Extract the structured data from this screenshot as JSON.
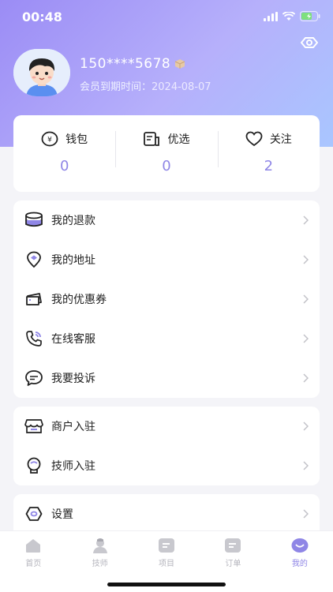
{
  "status": {
    "time": "00:48"
  },
  "profile": {
    "phone": "150****5678",
    "expire_label": "会员到期时间：",
    "expire_date": "2024-08-07"
  },
  "stats": [
    {
      "icon": "wallet-icon",
      "label": "钱包",
      "value": "0"
    },
    {
      "icon": "select-icon",
      "label": "优选",
      "value": "0"
    },
    {
      "icon": "heart-icon",
      "label": "关注",
      "value": "2"
    }
  ],
  "menu1": [
    {
      "icon": "refund-icon",
      "label": "我的退款"
    },
    {
      "icon": "location-icon",
      "label": "我的地址"
    },
    {
      "icon": "coupon-icon",
      "label": "我的优惠券"
    },
    {
      "icon": "service-phone-icon",
      "label": "在线客服"
    },
    {
      "icon": "complaint-icon",
      "label": "我要投诉"
    }
  ],
  "menu2": [
    {
      "icon": "store-icon",
      "label": "商户入驻"
    },
    {
      "icon": "technician-icon",
      "label": "技师入驻"
    }
  ],
  "menu3": [
    {
      "icon": "settings-icon",
      "label": "设置"
    }
  ],
  "tabbar": [
    {
      "icon": "home-icon",
      "label": "首页"
    },
    {
      "icon": "technician-tab-icon",
      "label": "技师"
    },
    {
      "icon": "project-icon",
      "label": "项目"
    },
    {
      "icon": "order-icon",
      "label": "订单"
    },
    {
      "icon": "mine-icon",
      "label": "我的"
    }
  ],
  "colors": {
    "accent": "#8f86e6",
    "hero_start": "#9b8cf5",
    "hero_end": "#a9c6ff"
  }
}
